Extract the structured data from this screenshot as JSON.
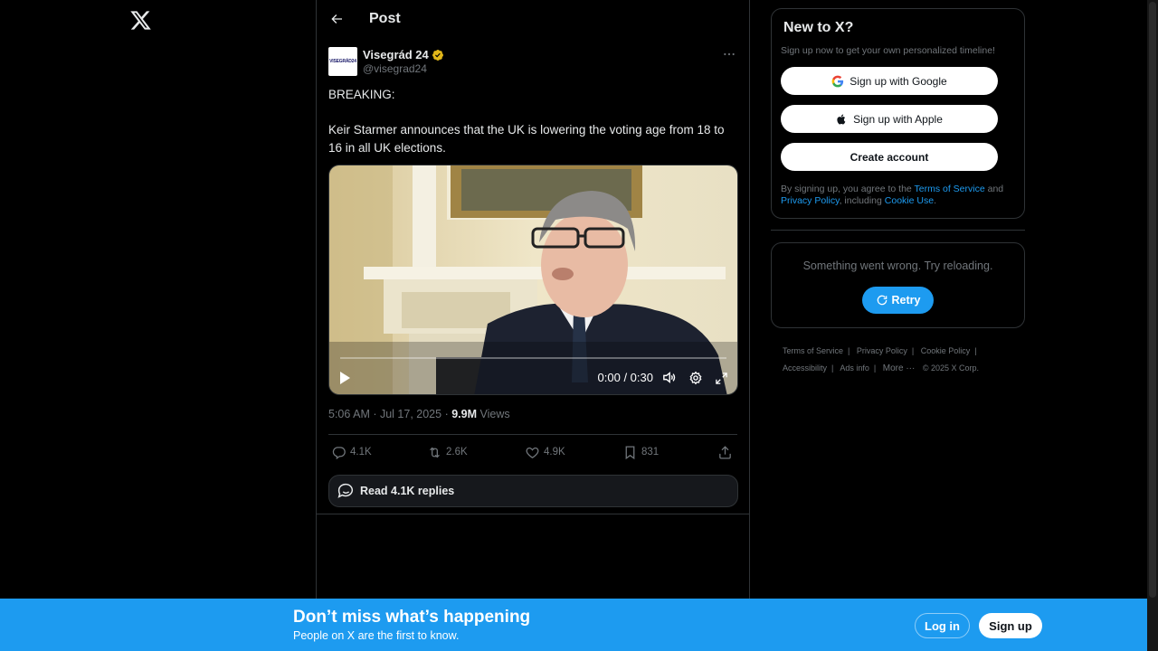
{
  "header": {
    "title": "Post"
  },
  "tweet": {
    "author_name": "Visegrád 24",
    "handle": "@visegrad24",
    "avatar_text": "VISEGRÁD24",
    "text": "BREAKING:\n\nKeir Starmer announces that the UK is lowering the voting age from 18 to 16 in all UK elections.",
    "video": {
      "time": "0:00 / 0:30",
      "progress": 0
    },
    "timestamp": "5:06 AM · Jul 17, 2025",
    "views_count": "9.9M",
    "views_label": "Views",
    "replies": "4.1K",
    "reposts": "2.6K",
    "likes": "4.9K",
    "bookmarks": "831",
    "read_replies": "Read 4.1K replies"
  },
  "signup_card": {
    "title": "New to X?",
    "subtitle": "Sign up now to get your own personalized timeline!",
    "google": "Sign up with Google",
    "apple": "Sign up with Apple",
    "create": "Create account",
    "legal_prefix": "By signing up, you agree to the ",
    "terms": "Terms of Service",
    "and": " and ",
    "privacy": "Privacy Policy",
    "including": ", including ",
    "cookie": "Cookie Use",
    "period": "."
  },
  "error_card": {
    "message": "Something went wrong. Try reloading.",
    "retry": "Retry"
  },
  "footer": {
    "terms": "Terms of Service",
    "privacy": "Privacy Policy",
    "cookie": "Cookie Policy",
    "accessibility": "Accessibility",
    "ads": "Ads info",
    "more": "More ···",
    "copyright": "© 2025 X Corp."
  },
  "bottom_bar": {
    "title": "Don’t miss what’s happening",
    "subtitle": "People on X are the first to know.",
    "login": "Log in",
    "signup": "Sign up"
  },
  "colors": {
    "accent": "#1d9bf0",
    "background": "#000000",
    "border": "#2f3336",
    "muted": "#71767b",
    "verified": "#e2b719"
  }
}
